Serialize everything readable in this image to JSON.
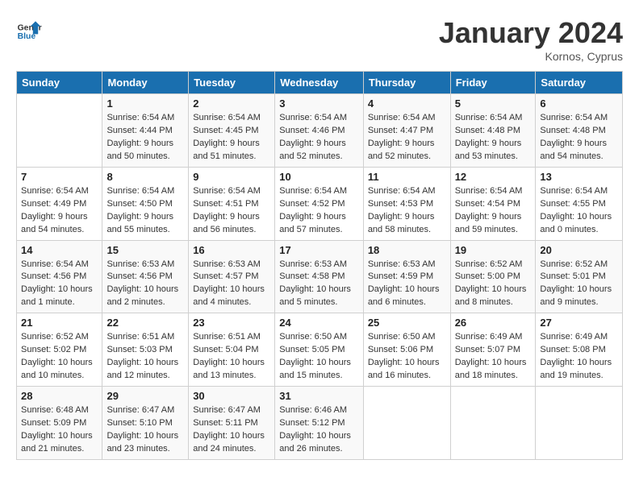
{
  "header": {
    "logo_line1": "General",
    "logo_line2": "Blue",
    "title": "January 2024",
    "subtitle": "Kornos, Cyprus"
  },
  "columns": [
    "Sunday",
    "Monday",
    "Tuesday",
    "Wednesday",
    "Thursday",
    "Friday",
    "Saturday"
  ],
  "weeks": [
    [
      {
        "day": "",
        "info": ""
      },
      {
        "day": "1",
        "info": "Sunrise: 6:54 AM\nSunset: 4:44 PM\nDaylight: 9 hours\nand 50 minutes."
      },
      {
        "day": "2",
        "info": "Sunrise: 6:54 AM\nSunset: 4:45 PM\nDaylight: 9 hours\nand 51 minutes."
      },
      {
        "day": "3",
        "info": "Sunrise: 6:54 AM\nSunset: 4:46 PM\nDaylight: 9 hours\nand 52 minutes."
      },
      {
        "day": "4",
        "info": "Sunrise: 6:54 AM\nSunset: 4:47 PM\nDaylight: 9 hours\nand 52 minutes."
      },
      {
        "day": "5",
        "info": "Sunrise: 6:54 AM\nSunset: 4:48 PM\nDaylight: 9 hours\nand 53 minutes."
      },
      {
        "day": "6",
        "info": "Sunrise: 6:54 AM\nSunset: 4:48 PM\nDaylight: 9 hours\nand 54 minutes."
      }
    ],
    [
      {
        "day": "7",
        "info": "Sunrise: 6:54 AM\nSunset: 4:49 PM\nDaylight: 9 hours\nand 54 minutes."
      },
      {
        "day": "8",
        "info": "Sunrise: 6:54 AM\nSunset: 4:50 PM\nDaylight: 9 hours\nand 55 minutes."
      },
      {
        "day": "9",
        "info": "Sunrise: 6:54 AM\nSunset: 4:51 PM\nDaylight: 9 hours\nand 56 minutes."
      },
      {
        "day": "10",
        "info": "Sunrise: 6:54 AM\nSunset: 4:52 PM\nDaylight: 9 hours\nand 57 minutes."
      },
      {
        "day": "11",
        "info": "Sunrise: 6:54 AM\nSunset: 4:53 PM\nDaylight: 9 hours\nand 58 minutes."
      },
      {
        "day": "12",
        "info": "Sunrise: 6:54 AM\nSunset: 4:54 PM\nDaylight: 9 hours\nand 59 minutes."
      },
      {
        "day": "13",
        "info": "Sunrise: 6:54 AM\nSunset: 4:55 PM\nDaylight: 10 hours\nand 0 minutes."
      }
    ],
    [
      {
        "day": "14",
        "info": "Sunrise: 6:54 AM\nSunset: 4:56 PM\nDaylight: 10 hours\nand 1 minute."
      },
      {
        "day": "15",
        "info": "Sunrise: 6:53 AM\nSunset: 4:56 PM\nDaylight: 10 hours\nand 2 minutes."
      },
      {
        "day": "16",
        "info": "Sunrise: 6:53 AM\nSunset: 4:57 PM\nDaylight: 10 hours\nand 4 minutes."
      },
      {
        "day": "17",
        "info": "Sunrise: 6:53 AM\nSunset: 4:58 PM\nDaylight: 10 hours\nand 5 minutes."
      },
      {
        "day": "18",
        "info": "Sunrise: 6:53 AM\nSunset: 4:59 PM\nDaylight: 10 hours\nand 6 minutes."
      },
      {
        "day": "19",
        "info": "Sunrise: 6:52 AM\nSunset: 5:00 PM\nDaylight: 10 hours\nand 8 minutes."
      },
      {
        "day": "20",
        "info": "Sunrise: 6:52 AM\nSunset: 5:01 PM\nDaylight: 10 hours\nand 9 minutes."
      }
    ],
    [
      {
        "day": "21",
        "info": "Sunrise: 6:52 AM\nSunset: 5:02 PM\nDaylight: 10 hours\nand 10 minutes."
      },
      {
        "day": "22",
        "info": "Sunrise: 6:51 AM\nSunset: 5:03 PM\nDaylight: 10 hours\nand 12 minutes."
      },
      {
        "day": "23",
        "info": "Sunrise: 6:51 AM\nSunset: 5:04 PM\nDaylight: 10 hours\nand 13 minutes."
      },
      {
        "day": "24",
        "info": "Sunrise: 6:50 AM\nSunset: 5:05 PM\nDaylight: 10 hours\nand 15 minutes."
      },
      {
        "day": "25",
        "info": "Sunrise: 6:50 AM\nSunset: 5:06 PM\nDaylight: 10 hours\nand 16 minutes."
      },
      {
        "day": "26",
        "info": "Sunrise: 6:49 AM\nSunset: 5:07 PM\nDaylight: 10 hours\nand 18 minutes."
      },
      {
        "day": "27",
        "info": "Sunrise: 6:49 AM\nSunset: 5:08 PM\nDaylight: 10 hours\nand 19 minutes."
      }
    ],
    [
      {
        "day": "28",
        "info": "Sunrise: 6:48 AM\nSunset: 5:09 PM\nDaylight: 10 hours\nand 21 minutes."
      },
      {
        "day": "29",
        "info": "Sunrise: 6:47 AM\nSunset: 5:10 PM\nDaylight: 10 hours\nand 23 minutes."
      },
      {
        "day": "30",
        "info": "Sunrise: 6:47 AM\nSunset: 5:11 PM\nDaylight: 10 hours\nand 24 minutes."
      },
      {
        "day": "31",
        "info": "Sunrise: 6:46 AM\nSunset: 5:12 PM\nDaylight: 10 hours\nand 26 minutes."
      },
      {
        "day": "",
        "info": ""
      },
      {
        "day": "",
        "info": ""
      },
      {
        "day": "",
        "info": ""
      }
    ]
  ]
}
